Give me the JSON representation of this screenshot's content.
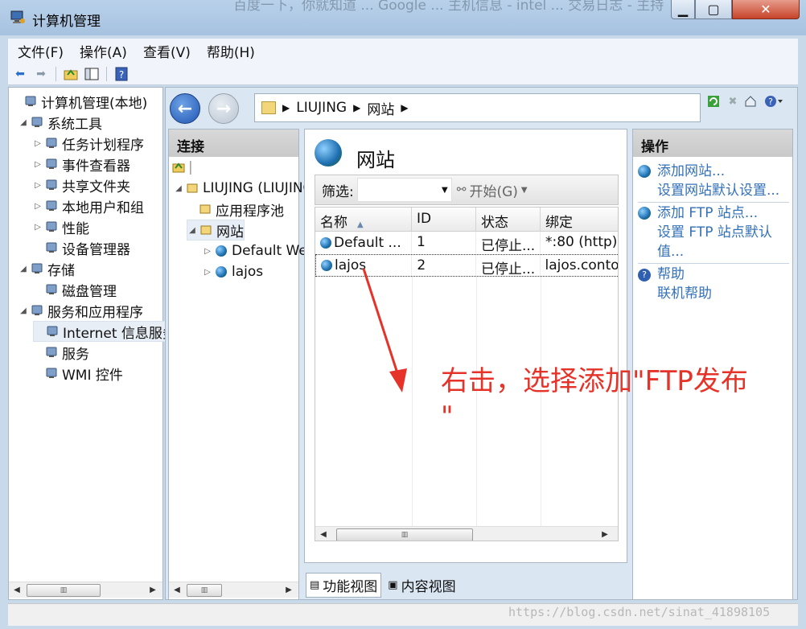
{
  "window": {
    "title": "计算机管理",
    "bg_tabs": "百度一下，你就知道 ... Google ... 主机信息 - intel ... 交易日志 - 主持"
  },
  "menu": [
    "文件(F)",
    "操作(A)",
    "查看(V)",
    "帮助(H)"
  ],
  "tree": [
    {
      "label": "计算机管理(本地)",
      "level": 0,
      "expander": "",
      "icon": "computer-icon"
    },
    {
      "label": "系统工具",
      "level": 1,
      "expander": "◢",
      "icon": "tools-icon"
    },
    {
      "label": "任务计划程序",
      "level": 2,
      "expander": "▷",
      "icon": "clock-icon"
    },
    {
      "label": "事件查看器",
      "level": 2,
      "expander": "▷",
      "icon": "event-icon"
    },
    {
      "label": "共享文件夹",
      "level": 2,
      "expander": "▷",
      "icon": "share-folder-icon"
    },
    {
      "label": "本地用户和组",
      "level": 2,
      "expander": "▷",
      "icon": "users-icon"
    },
    {
      "label": "性能",
      "level": 2,
      "expander": "▷",
      "icon": "performance-icon"
    },
    {
      "label": "设备管理器",
      "level": 2,
      "expander": "",
      "icon": "device-icon"
    },
    {
      "label": "存储",
      "level": 1,
      "expander": "◢",
      "icon": "storage-icon"
    },
    {
      "label": "磁盘管理",
      "level": 2,
      "expander": "",
      "icon": "disk-icon"
    },
    {
      "label": "服务和应用程序",
      "level": 1,
      "expander": "◢",
      "icon": "services-app-icon"
    },
    {
      "label": "Internet 信息服务(IIS)管理器",
      "level": 2,
      "expander": "",
      "icon": "iis-icon",
      "selected": true
    },
    {
      "label": "服务",
      "level": 2,
      "expander": "",
      "icon": "gear-icon"
    },
    {
      "label": "WMI 控件",
      "level": 2,
      "expander": "",
      "icon": "wmi-icon"
    }
  ],
  "address": {
    "parts": [
      "LIUJING",
      "网站"
    ]
  },
  "connections": {
    "header": "连接",
    "items": [
      {
        "label": "LIUJING (LIUJING\\liujing)",
        "level": 0,
        "expander": "◢"
      },
      {
        "label": "应用程序池",
        "level": 1,
        "expander": ""
      },
      {
        "label": "网站",
        "level": 1,
        "expander": "◢",
        "selected": true
      },
      {
        "label": "Default Web Site",
        "level": 2,
        "expander": "▷"
      },
      {
        "label": "lajos",
        "level": 2,
        "expander": "▷"
      }
    ]
  },
  "center": {
    "title": "网站",
    "filter_label": "筛选:",
    "filter_value": "",
    "start_button": "开始(G)",
    "columns": [
      "名称",
      "ID",
      "状态",
      "绑定"
    ],
    "rows": [
      {
        "name": "Default ...",
        "id": "1",
        "status": "已停止...",
        "binding": "*:80 (http)"
      },
      {
        "name": "lajos",
        "id": "2",
        "status": "已停止...",
        "binding": "lajos.contoso.com"
      }
    ],
    "views": [
      "功能视图",
      "内容视图"
    ]
  },
  "actions": {
    "header": "操作",
    "groups": [
      [
        "添加网站...",
        "设置网站默认设置..."
      ],
      [
        "添加 FTP 站点...",
        "设置 FTP 站点默认",
        "值..."
      ],
      [
        "帮助",
        "联机帮助"
      ]
    ]
  },
  "annotation": {
    "line1": "右击，选择添加\"FTP发布",
    "line2": "\"",
    "color": "#e6332a"
  },
  "watermark": "https://blog.csdn.net/sinat_41898105"
}
